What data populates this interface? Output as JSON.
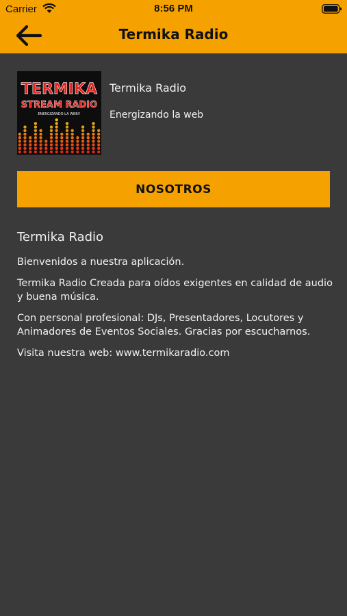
{
  "status_bar": {
    "carrier": "Carrier",
    "time": "8:56 PM"
  },
  "nav": {
    "title": "Termika Radio",
    "back_icon": "arrow-left-icon"
  },
  "station": {
    "name": "Termika Radio",
    "slogan": "Energizando la web",
    "logo": {
      "line1": "TERMIKA",
      "line2": "STREAM RADIO",
      "tagline": "ENERGIZANDO LA WEB!!"
    }
  },
  "button": {
    "label": "NOSOTROS"
  },
  "about": {
    "title": "Termika Radio",
    "paragraphs": [
      "Bienvenidos a nuestra aplicación.",
      "Termika Radio Creada para oídos exigentes en calidad de audio y buena música.",
      "Con personal profesional: DJs, Presentadores, Locutores y Animadores de Eventos Sociales. Gracias por escucharnos.",
      "Visita nuestra web: www.termikaradio.com"
    ]
  },
  "colors": {
    "accent": "#f5a200",
    "background": "#3a3a3a",
    "text": "#f2f2f2",
    "logo_red": "#e8231d"
  }
}
